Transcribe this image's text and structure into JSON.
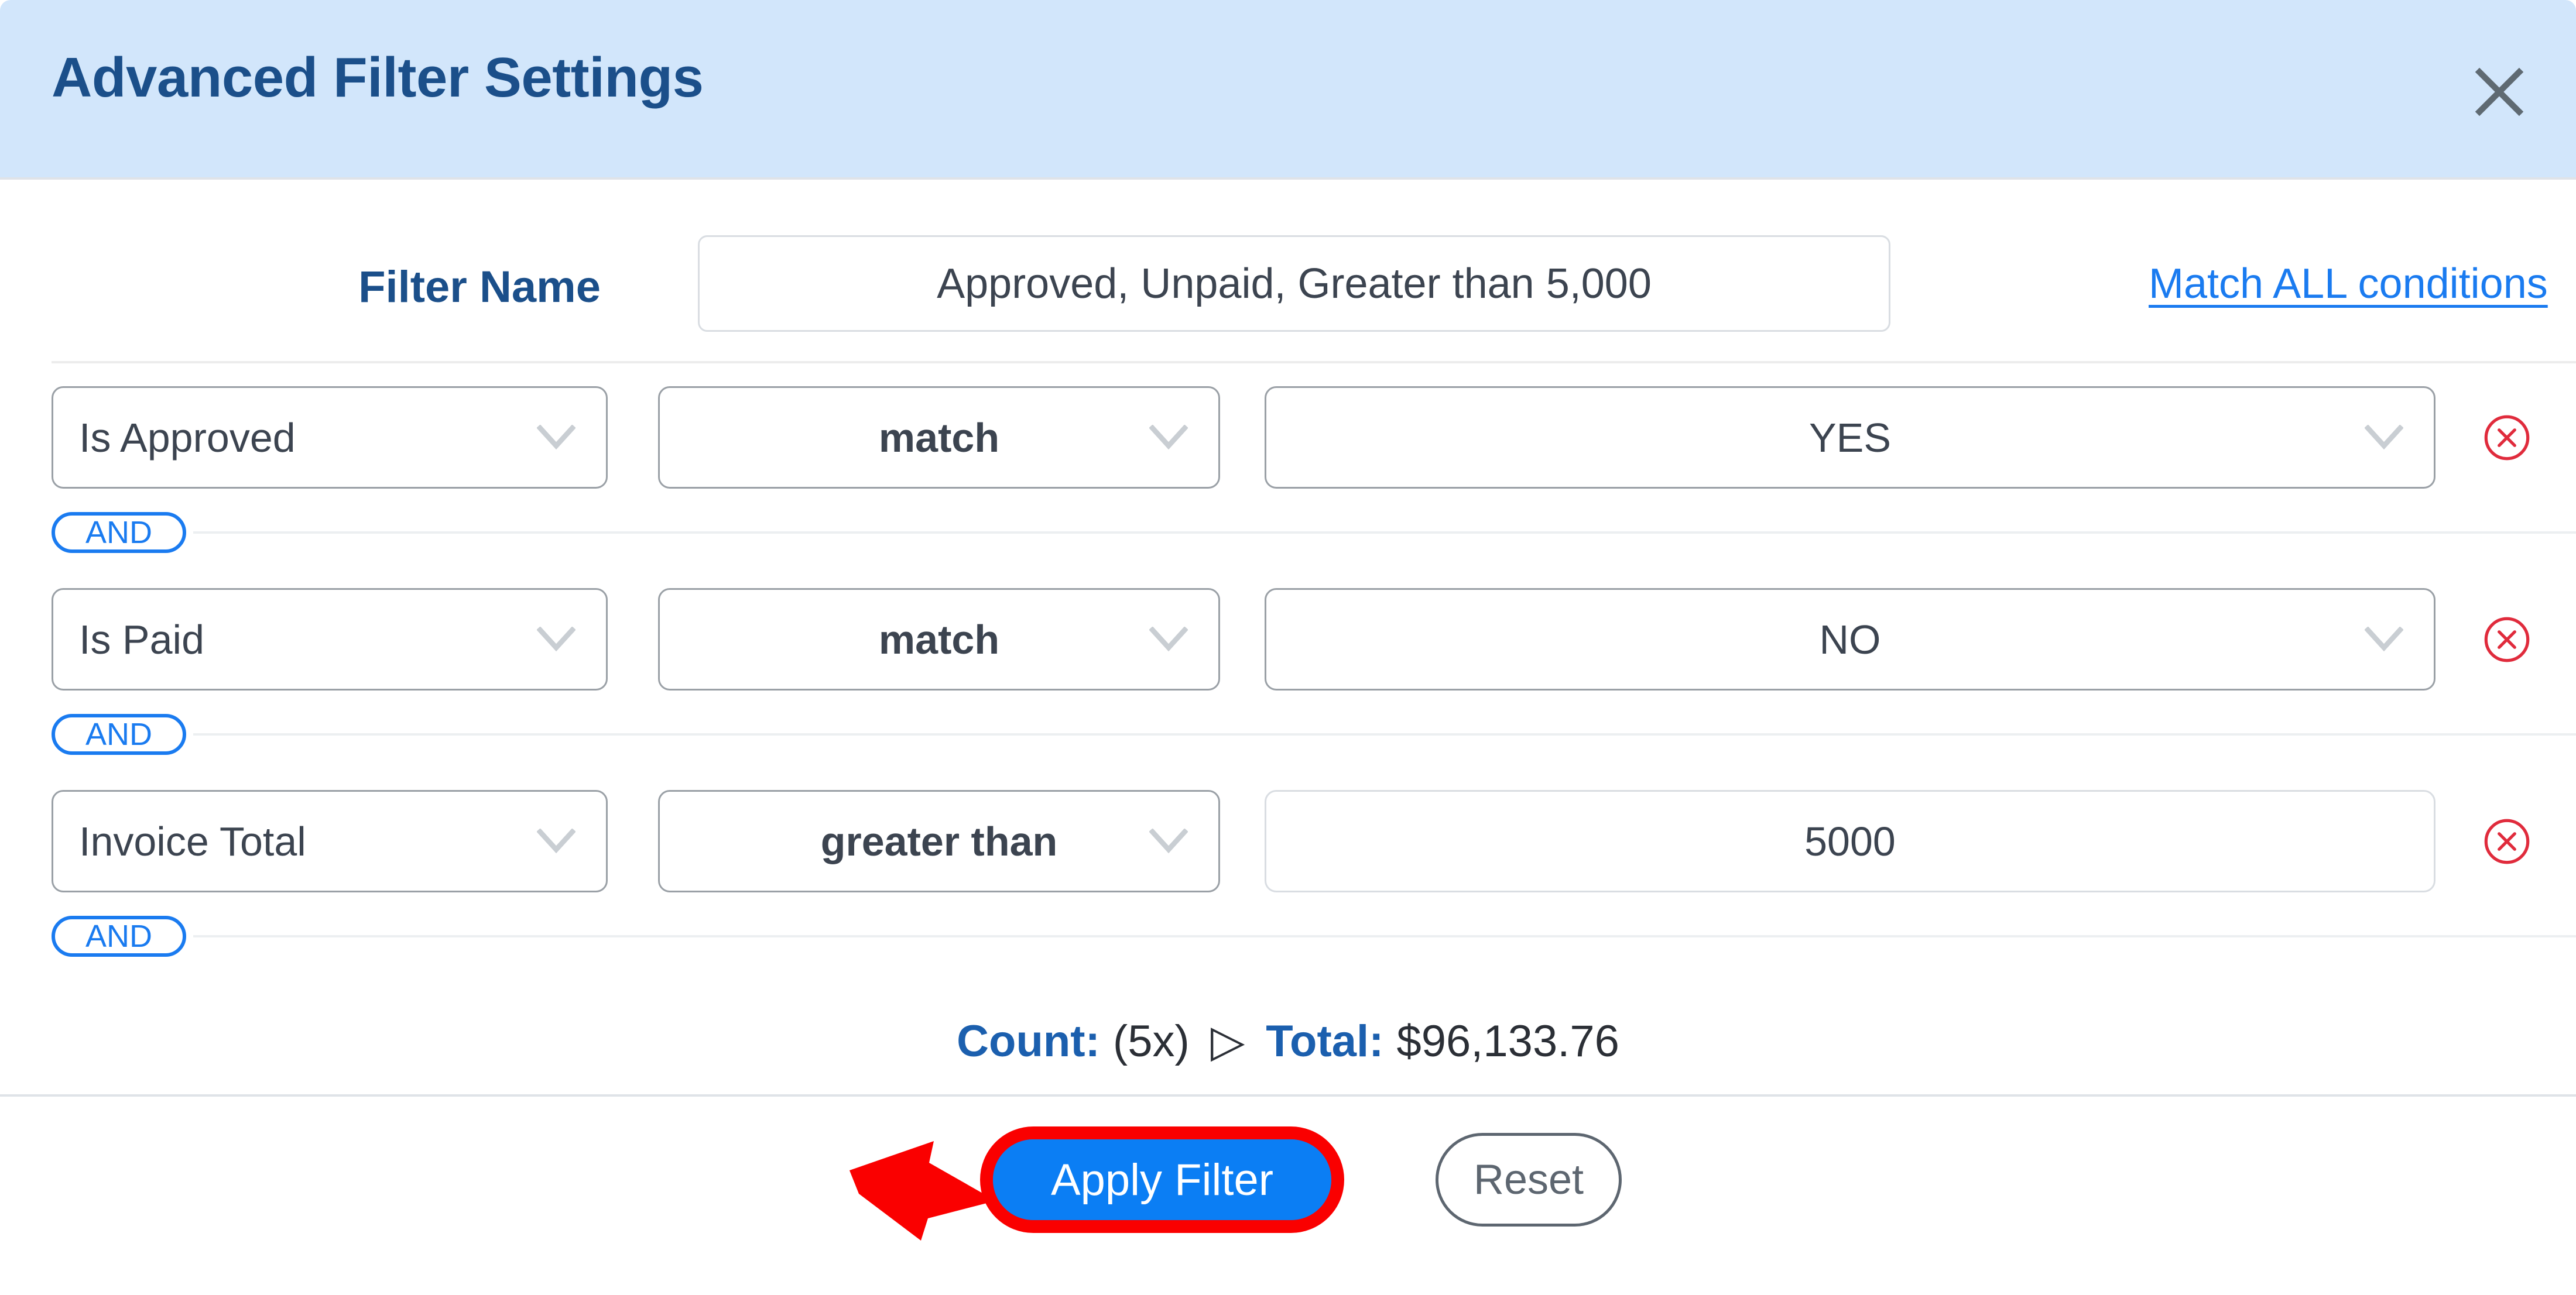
{
  "dialog": {
    "title": "Advanced Filter Settings",
    "close_icon": "close-icon"
  },
  "filter_name": {
    "label": "Filter Name",
    "value": "Approved, Unpaid, Greater than 5,000",
    "placeholder": "Filter Name",
    "match_link": "Match ALL conditions"
  },
  "conditions": [
    {
      "field": "Is Approved",
      "operator": "match",
      "value": "YES",
      "value_is_select": true,
      "delete_icon": "circle-x-icon",
      "joiner": "AND"
    },
    {
      "field": "Is Paid",
      "operator": "match",
      "value": "NO",
      "value_is_select": true,
      "delete_icon": "circle-x-icon",
      "joiner": "AND"
    },
    {
      "field": "Invoice Total",
      "operator": "greater than",
      "value": "5000",
      "value_is_select": false,
      "delete_icon": "circle-x-icon",
      "joiner": "AND"
    }
  ],
  "summary": {
    "count_label": "Count:",
    "count_value": "(5x)",
    "separator_icon": "play-triangle-icon",
    "separator_glyph": "▷",
    "total_label": "Total:",
    "total_value": "$96,133.76"
  },
  "footer": {
    "apply_label": "Apply Filter",
    "reset_label": "Reset"
  },
  "colors": {
    "header_bg": "#d2e6fb",
    "header_title": "#1b4f8a",
    "link_blue": "#1a7bf0",
    "primary_button": "#0b7ef4",
    "highlight_red": "#fa0000",
    "delete_red": "#e02b3c",
    "select_border": "#9aa0a6",
    "text": "#3c4450"
  }
}
